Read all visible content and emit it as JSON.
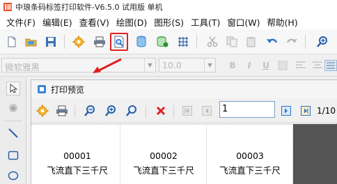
{
  "window": {
    "title": "中琅条码标签打印软件-V6.5.0 试用版 单机"
  },
  "menu": {
    "items": [
      "文件(F)",
      "编辑(E)",
      "查看(V)",
      "绘图(D)",
      "图形(S)",
      "工具(T)",
      "窗口(W)",
      "帮助(H)"
    ]
  },
  "format_bar": {
    "font_name": "微软雅黑",
    "font_size": "10.0"
  },
  "preview": {
    "title": "打印预览",
    "page_input": "1",
    "page_count": "1/10",
    "labels": [
      {
        "code": "00001",
        "text": "飞流直下三千尺"
      },
      {
        "code": "00002",
        "text": "飞流直下三千尺"
      },
      {
        "code": "00003",
        "text": "飞流直下三千尺"
      }
    ]
  },
  "colors": {
    "highlight": "#e02020",
    "accent_blue": "#1a6fd0",
    "preview_bg": "#545454"
  }
}
